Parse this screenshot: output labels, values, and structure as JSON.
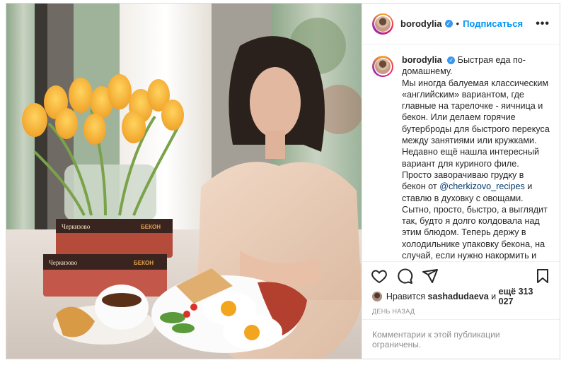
{
  "post": {
    "username": "borodylia",
    "follow_label": "Подписаться",
    "more_label": "•••",
    "verified_icon": "verified-badge-icon"
  },
  "caption": {
    "author": "borodylia",
    "text_before_mention": "Быстрая еда по-домашнему.\nМы иногда балуемая классическим «английским» вариантом, где главные на тарелочке - яичница и бекон. Или делаем горячие бутерброды для быстрого перекуса между занятиями или кружками. Недавно ещё нашла интересный вариант для куриного филе. Просто заворачиваю грудку в бекон от ",
    "mention": "@cherkizovo_recipes",
    "text_after_mention": " и ставлю в духовку с овощами. Сытно, просто, быстро, а выглядит так, будто я долго колдовала над этим блюдом. Теперь держу в холодильнике упаковку бекона, на случай, если нужно накормить и удивить домашних))."
  },
  "actions": {
    "like_icon": "heart-icon",
    "comment_icon": "comment-icon",
    "share_icon": "share-icon",
    "save_icon": "bookmark-icon"
  },
  "likes": {
    "prefix": "Нравится",
    "user": "sashadudaeva",
    "middle": "и",
    "rest": "ещё 313 027"
  },
  "timestamp": "ДЕНЬ НАЗАД",
  "comments_closed": "Комментарии к этой публикации ограничены.",
  "photo": {
    "brand": "Черкизово",
    "product": "БЕКОН"
  },
  "colors": {
    "link_blue": "#0095f6",
    "mention_blue": "#00376b",
    "muted_gray": "#8e8e8e",
    "border": "#dbdbdb"
  }
}
